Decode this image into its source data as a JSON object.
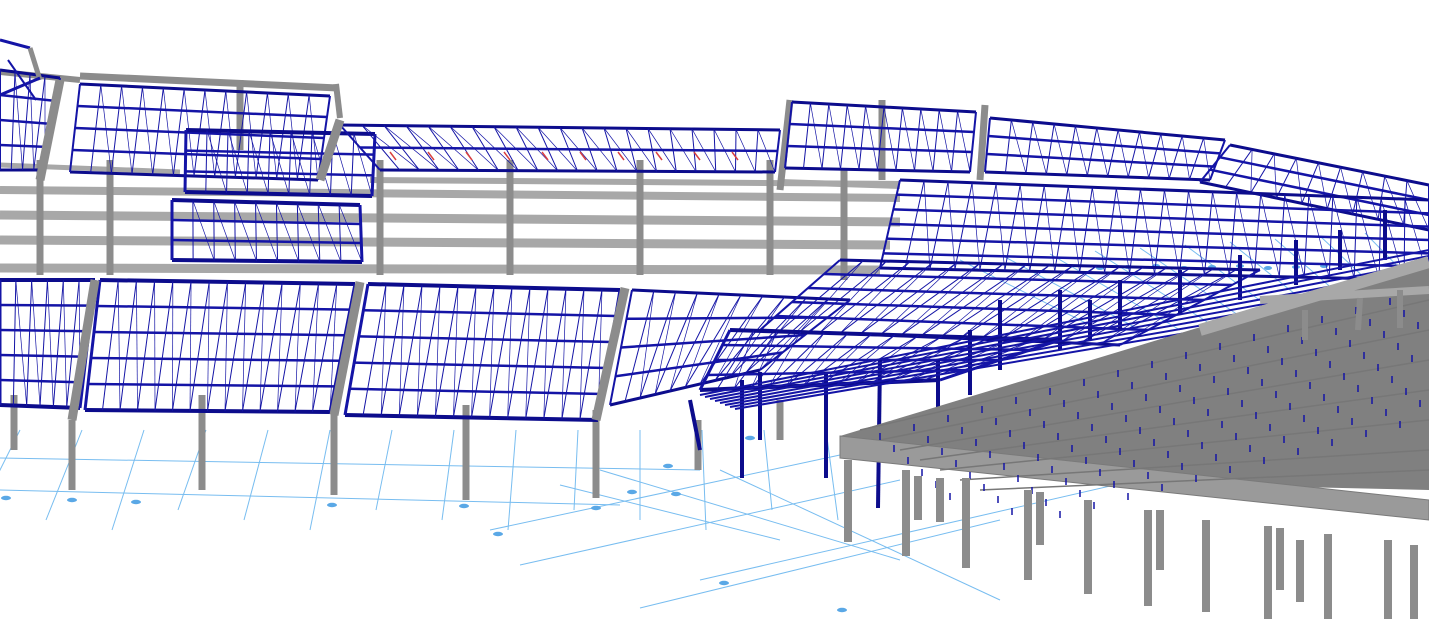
{
  "viewport": {
    "view_mode": "3d-perspective-wireframe",
    "background_color": "#ffffff"
  },
  "model_colors": {
    "steel_members": "#1414a6",
    "steel_members_dark": "#0c0c8c",
    "concrete_members": "#8c8c8c",
    "concrete_members_light": "#a8a8a8",
    "grid_lines": "#78bdf0",
    "support_nodes": "#5aa8e6",
    "highlight_members": "#d94040"
  },
  "elements": {
    "grid": {
      "icon": "grid-lines"
    },
    "supports": {
      "icon": "support-node"
    },
    "steel": {
      "icon": "steel-frame-member"
    },
    "concrete": {
      "icon": "concrete-beam-column"
    }
  }
}
